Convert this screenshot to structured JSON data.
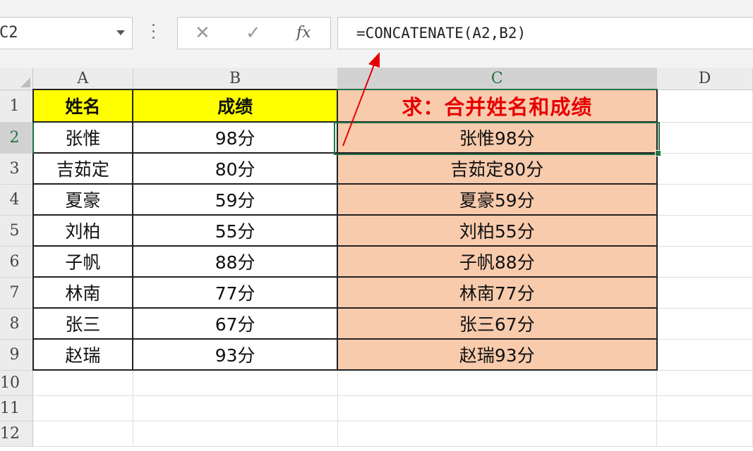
{
  "formula_bar": {
    "name_box": "C2",
    "cancel_glyph": "✕",
    "enter_glyph": "✓",
    "fx_label": "fx",
    "formula": "=CONCATENATE(A2,B2)"
  },
  "columns": [
    "A",
    "B",
    "C",
    "D"
  ],
  "selected_column": "C",
  "selected_row": "2",
  "header": {
    "a": "姓名",
    "b": "成绩",
    "c": "求：合并姓名和成绩"
  },
  "rows": [
    {
      "num": "2",
      "a": "张惟",
      "b": "98分",
      "c": "张惟98分"
    },
    {
      "num": "3",
      "a": "吉茹定",
      "b": "80分",
      "c": "吉茹定80分"
    },
    {
      "num": "4",
      "a": "夏豪",
      "b": "59分",
      "c": "夏豪59分"
    },
    {
      "num": "5",
      "a": "刘柏",
      "b": "55分",
      "c": "刘柏55分"
    },
    {
      "num": "6",
      "a": "子帆",
      "b": "88分",
      "c": "子帆88分"
    },
    {
      "num": "7",
      "a": "林南",
      "b": "77分",
      "c": "林南77分"
    },
    {
      "num": "8",
      "a": "张三",
      "b": "67分",
      "c": "张三67分"
    },
    {
      "num": "9",
      "a": "赵瑞",
      "b": "93分",
      "c": "赵瑞93分"
    }
  ],
  "header_row_num": "1",
  "empty_rows": [
    "10",
    "11",
    "12"
  ],
  "colors": {
    "header_fill": "#ffff00",
    "result_fill": "#f8cbad",
    "result_title": "#e60000",
    "selection": "#217346",
    "annotation_arrow": "#e60000"
  }
}
